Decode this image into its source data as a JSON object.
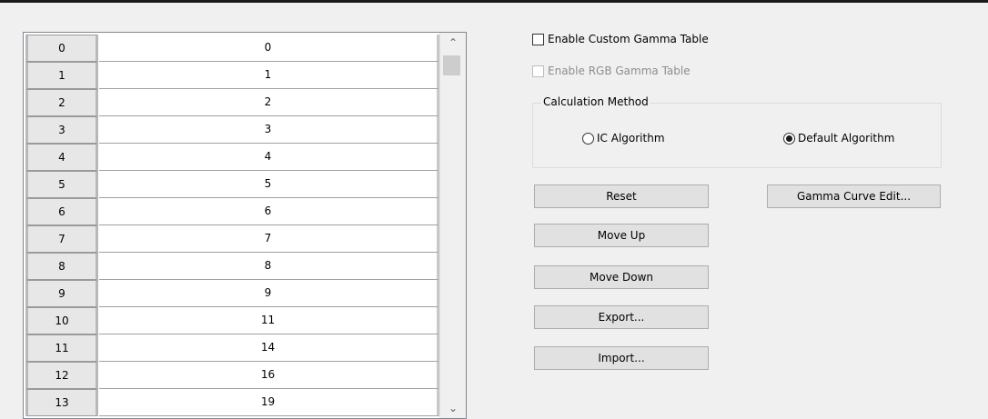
{
  "gamma_table": {
    "rows": [
      {
        "index": "0",
        "value": "0"
      },
      {
        "index": "1",
        "value": "1"
      },
      {
        "index": "2",
        "value": "2"
      },
      {
        "index": "3",
        "value": "3"
      },
      {
        "index": "4",
        "value": "4"
      },
      {
        "index": "5",
        "value": "5"
      },
      {
        "index": "6",
        "value": "6"
      },
      {
        "index": "7",
        "value": "7"
      },
      {
        "index": "8",
        "value": "8"
      },
      {
        "index": "9",
        "value": "9"
      },
      {
        "index": "10",
        "value": "11"
      },
      {
        "index": "11",
        "value": "14"
      },
      {
        "index": "12",
        "value": "16"
      },
      {
        "index": "13",
        "value": "19"
      }
    ],
    "scroll_up_icon": "chevron-up-icon",
    "scroll_down_icon": "chevron-down-icon"
  },
  "options": {
    "enable_custom_gamma_label": "Enable Custom Gamma Table",
    "enable_custom_gamma_checked": false,
    "enable_rgb_gamma_label": "Enable RGB Gamma Table",
    "enable_rgb_gamma_checked": false,
    "enable_rgb_gamma_disabled": true
  },
  "calculation_method": {
    "legend": "Calculation Method",
    "ic_algorithm_label": "IC Algorithm",
    "default_algorithm_label": "Default Algorithm",
    "selected": "Default Algorithm"
  },
  "buttons": {
    "reset": "Reset",
    "move_up": "Move Up",
    "move_down": "Move Down",
    "export": "Export...",
    "import": "Import...",
    "gamma_curve_edit": "Gamma Curve Edit..."
  }
}
